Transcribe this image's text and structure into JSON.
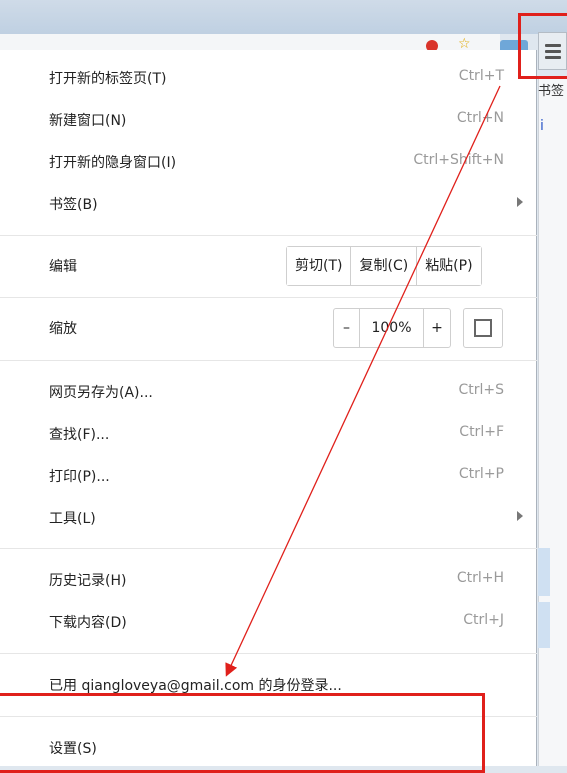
{
  "menu": {
    "new_tab": {
      "label": "打开新的标签页(T)",
      "shortcut": "Ctrl+T"
    },
    "new_window": {
      "label": "新建窗口(N)",
      "shortcut": "Ctrl+N"
    },
    "incognito": {
      "label": "打开新的隐身窗口(I)",
      "shortcut": "Ctrl+Shift+N"
    },
    "bookmarks": {
      "label": "书签(B)"
    },
    "edit": {
      "label": "编辑",
      "cut": "剪切(T)",
      "copy": "复制(C)",
      "paste": "粘贴(P)"
    },
    "zoom": {
      "label": "缩放",
      "minus": "–",
      "level": "100%",
      "plus": "+"
    },
    "save_as": {
      "label": "网页另存为(A)...",
      "shortcut": "Ctrl+S"
    },
    "find": {
      "label": "查找(F)...",
      "shortcut": "Ctrl+F"
    },
    "print": {
      "label": "打印(P)...",
      "shortcut": "Ctrl+P"
    },
    "tools": {
      "label": "工具(L)"
    },
    "history": {
      "label": "历史记录(H)",
      "shortcut": "Ctrl+H"
    },
    "downloads": {
      "label": "下载内容(D)",
      "shortcut": "Ctrl+J"
    },
    "signed_in": {
      "label": "已用 qiangloveya@gmail.com 的身份登录..."
    },
    "settings": {
      "label": "设置(S)"
    }
  },
  "side_panel": {
    "bookmark_text": "书签",
    "fragment": "i"
  },
  "colors": {
    "highlight": "#e0201b",
    "arrow": "#e0201b"
  },
  "icons": {
    "menu": "hamburger-icon",
    "fullscreen": "fullscreen-icon",
    "submenu": "chevron-right-icon"
  }
}
